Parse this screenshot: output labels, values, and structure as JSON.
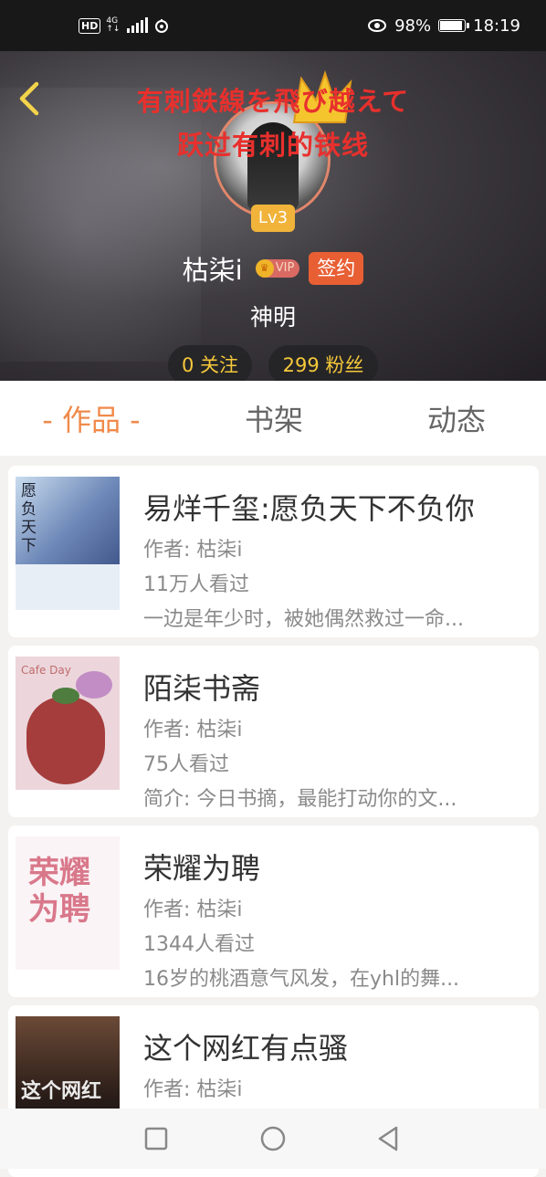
{
  "status_bar": {
    "hd": "HD",
    "network": "4G",
    "battery": "98%",
    "battery_level": 0.98,
    "time": "18:19"
  },
  "profile": {
    "overlay_line1": "有刺鉄線を飛び越えて",
    "overlay_line2": "跃过有刺的铁线",
    "level": "Lv3",
    "username": "枯柒i",
    "vip_label": "VIP",
    "signed_label": "签约",
    "title": "神明",
    "follow": "0 关注",
    "fans": "299 粉丝"
  },
  "tabs": [
    {
      "label": "- 作品 -",
      "active": true
    },
    {
      "label": "书架",
      "active": false
    },
    {
      "label": "动态",
      "active": false
    }
  ],
  "books": [
    {
      "title": "易烊千玺:愿负天下不负你",
      "author": "作者: 枯柒i",
      "views": "11万人看过",
      "summary": "一边是年少时，被她偶然救过一命..."
    },
    {
      "title": "陌柒书斋",
      "author": "作者: 枯柒i",
      "views": "75人看过",
      "summary": "简介: 今日书摘，最能打动你的文..."
    },
    {
      "title": "荣耀为聘",
      "author": "作者: 枯柒i",
      "views": "1344人看过",
      "summary": "16岁的桃酒意气风发，在yhl的舞..."
    },
    {
      "title": "这个网红有点骚",
      "author": "作者: 枯柒i",
      "views": "",
      "summary": ""
    }
  ],
  "covers": {
    "book1_text": "愿负天下",
    "book2_text": "Cafe Day",
    "book3_text": "荣耀为聘",
    "book4_text": "这个网红"
  },
  "colors": {
    "accent": "#f08a4b",
    "overlay_red": "#e8302d",
    "level_gold": "#f1b33a",
    "signed_orange": "#e85f34",
    "pill_text": "#f6c83a"
  }
}
